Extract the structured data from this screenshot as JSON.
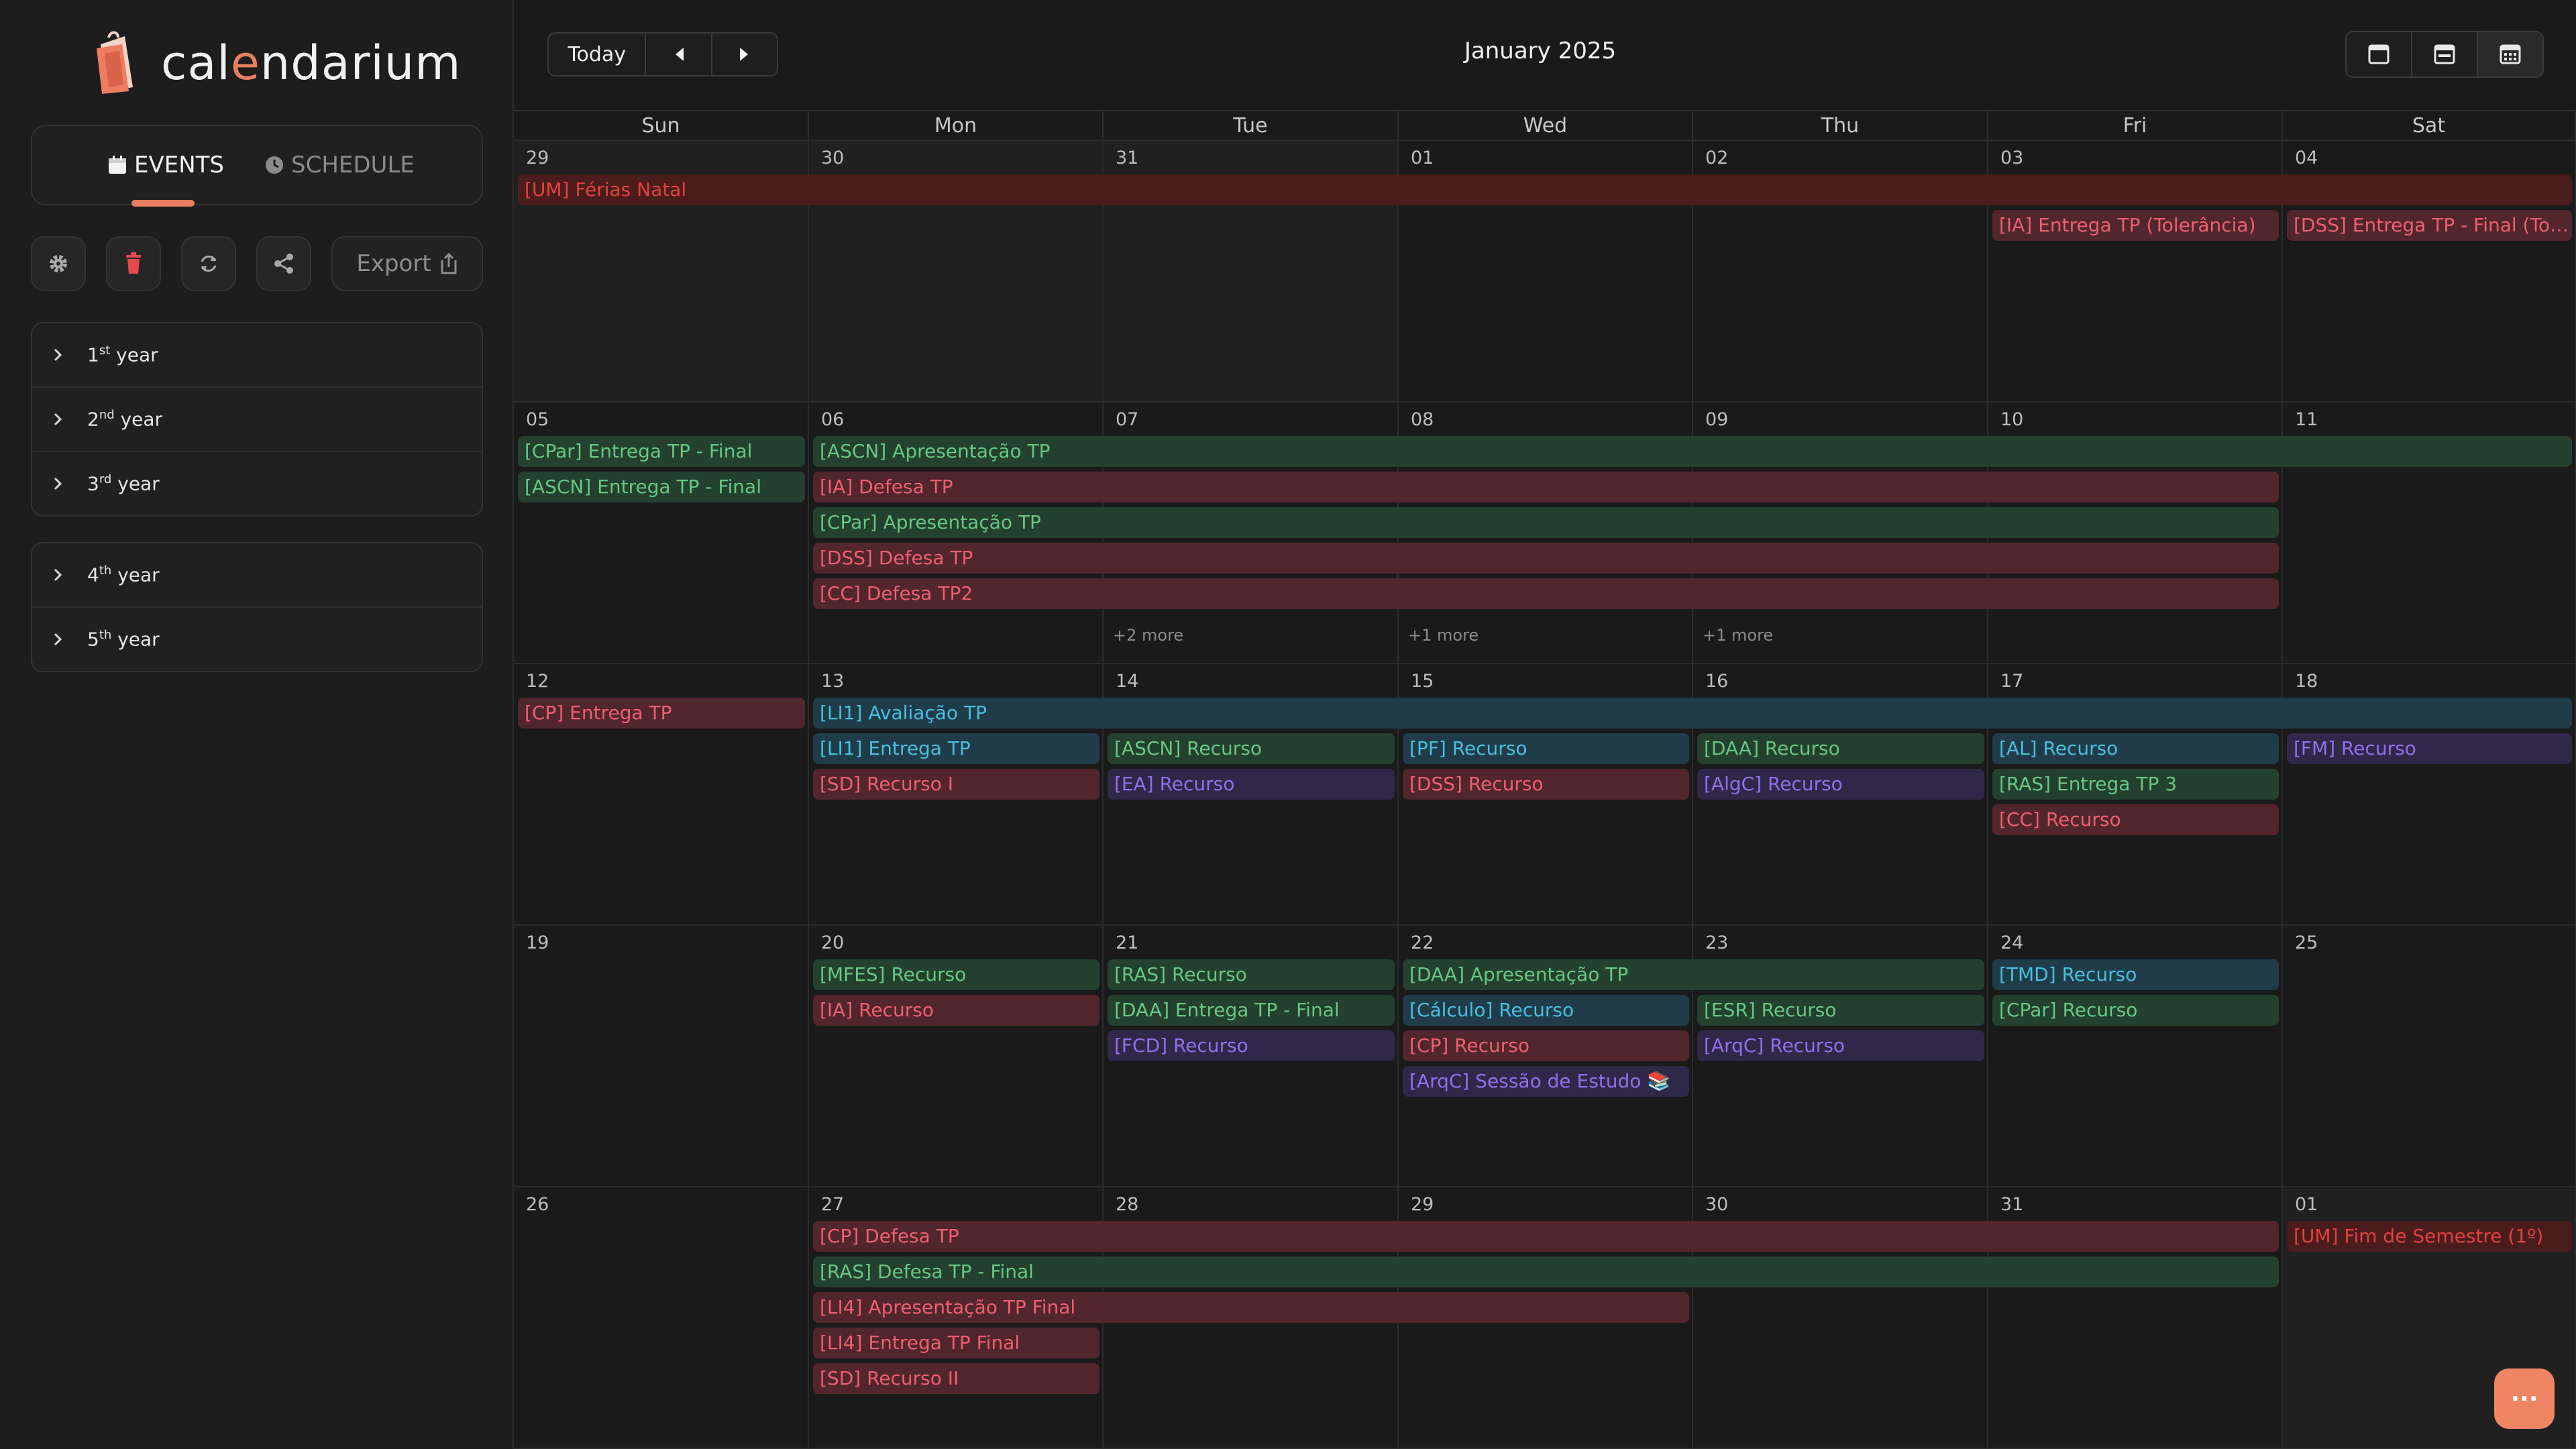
{
  "app": {
    "logo_prefix": "cal",
    "logo_accent": "e",
    "logo_suffix": "ndarium",
    "accent_color": "#e8805f"
  },
  "sidebar": {
    "tabs": [
      {
        "label": "EVENTS",
        "icon": "calendar-icon",
        "active": true
      },
      {
        "label": "SCHEDULE",
        "icon": "clock-icon",
        "active": false
      }
    ],
    "tools": [
      {
        "name": "settings-button",
        "icon": "gear-icon"
      },
      {
        "name": "delete-button",
        "icon": "trash-icon"
      },
      {
        "name": "refresh-button",
        "icon": "refresh-icon"
      },
      {
        "name": "share-button",
        "icon": "share-icon"
      }
    ],
    "export_label": "Export",
    "year_groups": [
      [
        {
          "num": "1",
          "sup": "st",
          "label": "year"
        },
        {
          "num": "2",
          "sup": "nd",
          "label": "year"
        },
        {
          "num": "3",
          "sup": "rd",
          "label": "year"
        }
      ],
      [
        {
          "num": "4",
          "sup": "th",
          "label": "year"
        },
        {
          "num": "5",
          "sup": "th",
          "label": "year"
        }
      ]
    ]
  },
  "calendar": {
    "today_label": "Today",
    "month_title": "January 2025",
    "weekdays": [
      "Sun",
      "Mon",
      "Tue",
      "Wed",
      "Thu",
      "Fri",
      "Sat"
    ],
    "weeks": [
      {
        "days": [
          {
            "n": "29",
            "outside": true
          },
          {
            "n": "30",
            "outside": true
          },
          {
            "n": "31",
            "outside": true
          },
          {
            "n": "01"
          },
          {
            "n": "02"
          },
          {
            "n": "03"
          },
          {
            "n": "04"
          }
        ]
      },
      {
        "days": [
          {
            "n": "05"
          },
          {
            "n": "06"
          },
          {
            "n": "07",
            "more": "+2 more"
          },
          {
            "n": "08",
            "more": "+1 more"
          },
          {
            "n": "09",
            "more": "+1 more"
          },
          {
            "n": "10"
          },
          {
            "n": "11"
          }
        ]
      },
      {
        "days": [
          {
            "n": "12"
          },
          {
            "n": "13"
          },
          {
            "n": "14"
          },
          {
            "n": "15"
          },
          {
            "n": "16"
          },
          {
            "n": "17"
          },
          {
            "n": "18"
          }
        ]
      },
      {
        "days": [
          {
            "n": "19"
          },
          {
            "n": "20"
          },
          {
            "n": "21"
          },
          {
            "n": "22"
          },
          {
            "n": "23"
          },
          {
            "n": "24"
          },
          {
            "n": "25"
          }
        ]
      },
      {
        "days": [
          {
            "n": "26"
          },
          {
            "n": "27"
          },
          {
            "n": "28"
          },
          {
            "n": "29"
          },
          {
            "n": "30"
          },
          {
            "n": "31"
          },
          {
            "n": "01",
            "outside": true
          }
        ]
      }
    ],
    "colors": {
      "red": {
        "bg": "#4a1c1c",
        "fg": "#e0433f"
      },
      "pink": {
        "bg": "#51262c",
        "fg": "#ee5f73"
      },
      "green": {
        "bg": "#24402e",
        "fg": "#67c784"
      },
      "teal": {
        "bg": "#1f3c48",
        "fg": "#48bfe0"
      },
      "purple": {
        "bg": "#2f2848",
        "fg": "#9070ea"
      }
    },
    "events": [
      {
        "title": "[UM] Férias Natal",
        "week": 0,
        "start": 0,
        "span": 7,
        "slot": 0,
        "color": "red"
      },
      {
        "title": "[IA] Entrega TP (Tolerância)",
        "week": 0,
        "start": 5,
        "span": 1,
        "slot": 1,
        "color": "pink"
      },
      {
        "title": "[DSS] Entrega TP - Final (Tolerância)",
        "week": 0,
        "start": 6,
        "span": 1,
        "slot": 1,
        "color": "pink"
      },
      {
        "title": "[CPar] Entrega TP - Final",
        "week": 1,
        "start": 0,
        "span": 1,
        "slot": 0,
        "color": "green"
      },
      {
        "title": "[ASCN] Entrega TP - Final",
        "week": 1,
        "start": 0,
        "span": 1,
        "slot": 1,
        "color": "green"
      },
      {
        "title": "[ASCN] Apresentação TP",
        "week": 1,
        "start": 1,
        "span": 6,
        "slot": 0,
        "color": "green"
      },
      {
        "title": "[IA] Defesa TP",
        "week": 1,
        "start": 1,
        "span": 5,
        "slot": 1,
        "color": "pink"
      },
      {
        "title": "[CPar] Apresentação TP",
        "week": 1,
        "start": 1,
        "span": 5,
        "slot": 2,
        "color": "green"
      },
      {
        "title": "[DSS] Defesa TP",
        "week": 1,
        "start": 1,
        "span": 5,
        "slot": 3,
        "color": "pink"
      },
      {
        "title": "[CC] Defesa TP2",
        "week": 1,
        "start": 1,
        "span": 5,
        "slot": 4,
        "color": "pink"
      },
      {
        "title": "[CP] Entrega TP",
        "week": 2,
        "start": 0,
        "span": 1,
        "slot": 0,
        "color": "pink"
      },
      {
        "title": "[LI1] Avaliação TP",
        "week": 2,
        "start": 1,
        "span": 6,
        "slot": 0,
        "color": "teal"
      },
      {
        "title": "[LI1] Entrega TP",
        "week": 2,
        "start": 1,
        "span": 1,
        "slot": 1,
        "color": "teal"
      },
      {
        "title": "[SD] Recurso I",
        "week": 2,
        "start": 1,
        "span": 1,
        "slot": 2,
        "color": "pink"
      },
      {
        "title": "[ASCN] Recurso",
        "week": 2,
        "start": 2,
        "span": 1,
        "slot": 1,
        "color": "green"
      },
      {
        "title": "[EA] Recurso",
        "week": 2,
        "start": 2,
        "span": 1,
        "slot": 2,
        "color": "purple"
      },
      {
        "title": "[PF] Recurso",
        "week": 2,
        "start": 3,
        "span": 1,
        "slot": 1,
        "color": "teal"
      },
      {
        "title": "[DSS] Recurso",
        "week": 2,
        "start": 3,
        "span": 1,
        "slot": 2,
        "color": "pink"
      },
      {
        "title": "[DAA] Recurso",
        "week": 2,
        "start": 4,
        "span": 1,
        "slot": 1,
        "color": "green"
      },
      {
        "title": "[AlgC] Recurso",
        "week": 2,
        "start": 4,
        "span": 1,
        "slot": 2,
        "color": "purple"
      },
      {
        "title": "[AL] Recurso",
        "week": 2,
        "start": 5,
        "span": 1,
        "slot": 1,
        "color": "teal"
      },
      {
        "title": "[RAS] Entrega TP 3",
        "week": 2,
        "start": 5,
        "span": 1,
        "slot": 2,
        "color": "green"
      },
      {
        "title": "[CC] Recurso",
        "week": 2,
        "start": 5,
        "span": 1,
        "slot": 3,
        "color": "pink"
      },
      {
        "title": "[FM] Recurso",
        "week": 2,
        "start": 6,
        "span": 1,
        "slot": 1,
        "color": "purple"
      },
      {
        "title": "[MFES] Recurso",
        "week": 3,
        "start": 1,
        "span": 1,
        "slot": 0,
        "color": "green"
      },
      {
        "title": "[IA] Recurso",
        "week": 3,
        "start": 1,
        "span": 1,
        "slot": 1,
        "color": "pink"
      },
      {
        "title": "[RAS] Recurso",
        "week": 3,
        "start": 2,
        "span": 1,
        "slot": 0,
        "color": "green"
      },
      {
        "title": "[DAA] Entrega TP - Final",
        "week": 3,
        "start": 2,
        "span": 1,
        "slot": 1,
        "color": "green"
      },
      {
        "title": "[FCD] Recurso",
        "week": 3,
        "start": 2,
        "span": 1,
        "slot": 2,
        "color": "purple"
      },
      {
        "title": "[DAA] Apresentação TP",
        "week": 3,
        "start": 3,
        "span": 2,
        "slot": 0,
        "color": "green"
      },
      {
        "title": "[Cálculo] Recurso",
        "week": 3,
        "start": 3,
        "span": 1,
        "slot": 1,
        "color": "teal"
      },
      {
        "title": "[CP] Recurso",
        "week": 3,
        "start": 3,
        "span": 1,
        "slot": 2,
        "color": "pink"
      },
      {
        "title": "[ArqC] Sessão de Estudo 📚",
        "week": 3,
        "start": 3,
        "span": 1,
        "slot": 3,
        "color": "purple"
      },
      {
        "title": "[ESR] Recurso",
        "week": 3,
        "start": 4,
        "span": 1,
        "slot": 1,
        "color": "green"
      },
      {
        "title": "[ArqC] Recurso",
        "week": 3,
        "start": 4,
        "span": 1,
        "slot": 2,
        "color": "purple"
      },
      {
        "title": "[TMD] Recurso",
        "week": 3,
        "start": 5,
        "span": 1,
        "slot": 0,
        "color": "teal"
      },
      {
        "title": "[CPar] Recurso",
        "week": 3,
        "start": 5,
        "span": 1,
        "slot": 1,
        "color": "green"
      },
      {
        "title": "[CP] Defesa TP",
        "week": 4,
        "start": 1,
        "span": 5,
        "slot": 0,
        "color": "pink"
      },
      {
        "title": "[RAS] Defesa TP - Final",
        "week": 4,
        "start": 1,
        "span": 5,
        "slot": 1,
        "color": "green"
      },
      {
        "title": "[LI4] Apresentação TP Final",
        "week": 4,
        "start": 1,
        "span": 3,
        "slot": 2,
        "color": "pink"
      },
      {
        "title": "[LI4] Entrega TP Final",
        "week": 4,
        "start": 1,
        "span": 1,
        "slot": 3,
        "color": "pink"
      },
      {
        "title": "[SD] Recurso II",
        "week": 4,
        "start": 1,
        "span": 1,
        "slot": 4,
        "color": "pink"
      },
      {
        "title": "[UM] Fim de Semestre (1º)",
        "week": 4,
        "start": 6,
        "span": 1,
        "slot": 0,
        "color": "red"
      }
    ]
  },
  "fab": {
    "label": "···",
    "icon": "more-icon"
  }
}
